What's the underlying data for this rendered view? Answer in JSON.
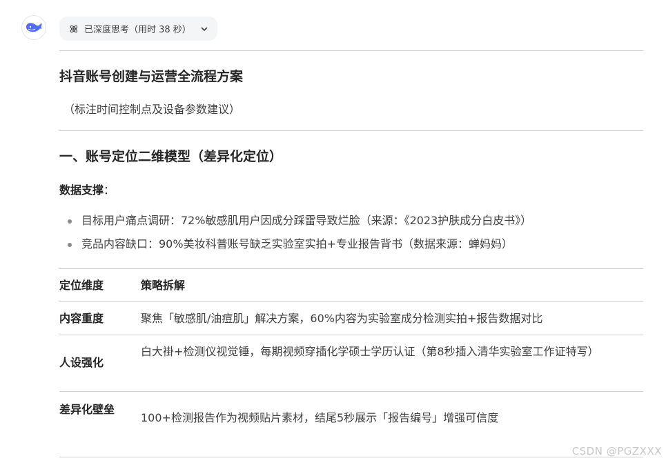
{
  "thinking": {
    "label": "已深度思考（用时 38 秒）"
  },
  "doc": {
    "title": "抖音账号创建与运营全流程方案",
    "subtitle": "（标注时间控制点及设备参数建议）",
    "section1_heading": "一、账号定位二维模型（差异化定位）",
    "support_label": "数据支撑",
    "support_colon": "：",
    "bullets": [
      "目标用户痛点调研：72%敏感肌用户因成分踩雷导致烂脸（来源：《2023护肤成分白皮书》）",
      "竞品内容缺口：90%美妆科普账号缺乏实验室实拍+专业报告背书（数据来源：蝉妈妈）"
    ],
    "table": {
      "headers": [
        "定位维度",
        "策略拆解"
      ],
      "rows": [
        [
          "内容重度",
          "聚焦「敏感肌/油痘肌」解决方案，60%内容为实验室成分检测实拍+报告数据对比"
        ],
        [
          "人设强化",
          "白大褂+检测仪视觉锤，每期视频穿插化学硕士学历认证（第8秒插入清华实验室工作证特写）"
        ],
        [
          "差异化壁垒",
          "100+检测报告作为视频贴片素材，结尾5秒展示「报告编号」增强可信度"
        ]
      ]
    }
  },
  "watermark": "CSDN @PGZXXX",
  "colors": {
    "brand": "#4d6bfe",
    "text": "#262626",
    "muted": "#404040",
    "divider": "#d0d0d0",
    "pill_bg": "#f4f5f7"
  }
}
